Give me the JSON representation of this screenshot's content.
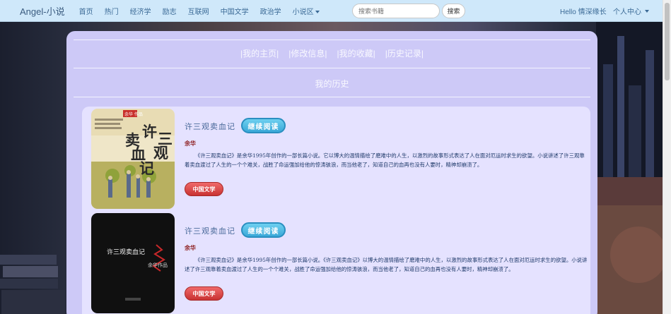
{
  "navbar": {
    "brand": "Angel-小说",
    "items": [
      "首页",
      "热门",
      "经济学",
      "励志",
      "互联网",
      "中国文学",
      "政治学"
    ],
    "dropdown_label": "小说区",
    "search_placeholder": "搜索书籍",
    "search_button": "搜索",
    "greeting": "Hello 情深缘长",
    "user_menu": "个人中心"
  },
  "tabs": [
    "|我的主页|",
    "|修改信息|",
    "|我的收藏|",
    "|历史记录|"
  ],
  "section_title": "我的历史",
  "books": [
    {
      "title": "许三观卖血记",
      "continue_label": "继续阅读",
      "author": "余华",
      "description": "《许三观卖血记》是余华1995年创作的一部长篇小说。它以博大的温情描绘了磨难中的人生，以激烈的故事形式表达了人在面对厄运时求生的欲望。小说讲述了许三观靠着卖血渡过了人生的一个个难关，战胜了命运强加给他的惊涛骇浪，而当他老了，知道自己的血再也没有人要时，精神却崩溃了。",
      "genre": "中国文学",
      "cover_title_chars": [
        "许",
        "三",
        "观",
        "卖",
        "血",
        "记"
      ],
      "cover_badge": "余华 作品"
    },
    {
      "title": "许三观卖血记",
      "continue_label": "继续阅读",
      "author": "余华",
      "description": "《许三观卖血记》是余华1995年创作的一部长篇小说。《许三观卖血记》以博大的温情描绘了磨难中的人生，以激烈的故事形式表达了人在面对厄运时求生的欲望。小说讲述了许三观靠着卖血渡过了人生的一个个难关，战胜了命运强加给他的惊涛骇浪，而当他老了，知道自己的血再也没有人要时，精神却崩溃了。",
      "genre": "中国文学",
      "cover_title": "许三观卖血记",
      "cover_author": "余华作品"
    }
  ],
  "colors": {
    "navbar_bg": "#cfe8fa",
    "panel_bg": "#cdc9f7",
    "inner_bg": "#e5e2ff",
    "continue_btn": "#3aa8d8",
    "genre_btn": "#c83232",
    "author_text": "#8b1a1a"
  },
  "icons": {
    "dropdown": "caret-down-icon"
  }
}
